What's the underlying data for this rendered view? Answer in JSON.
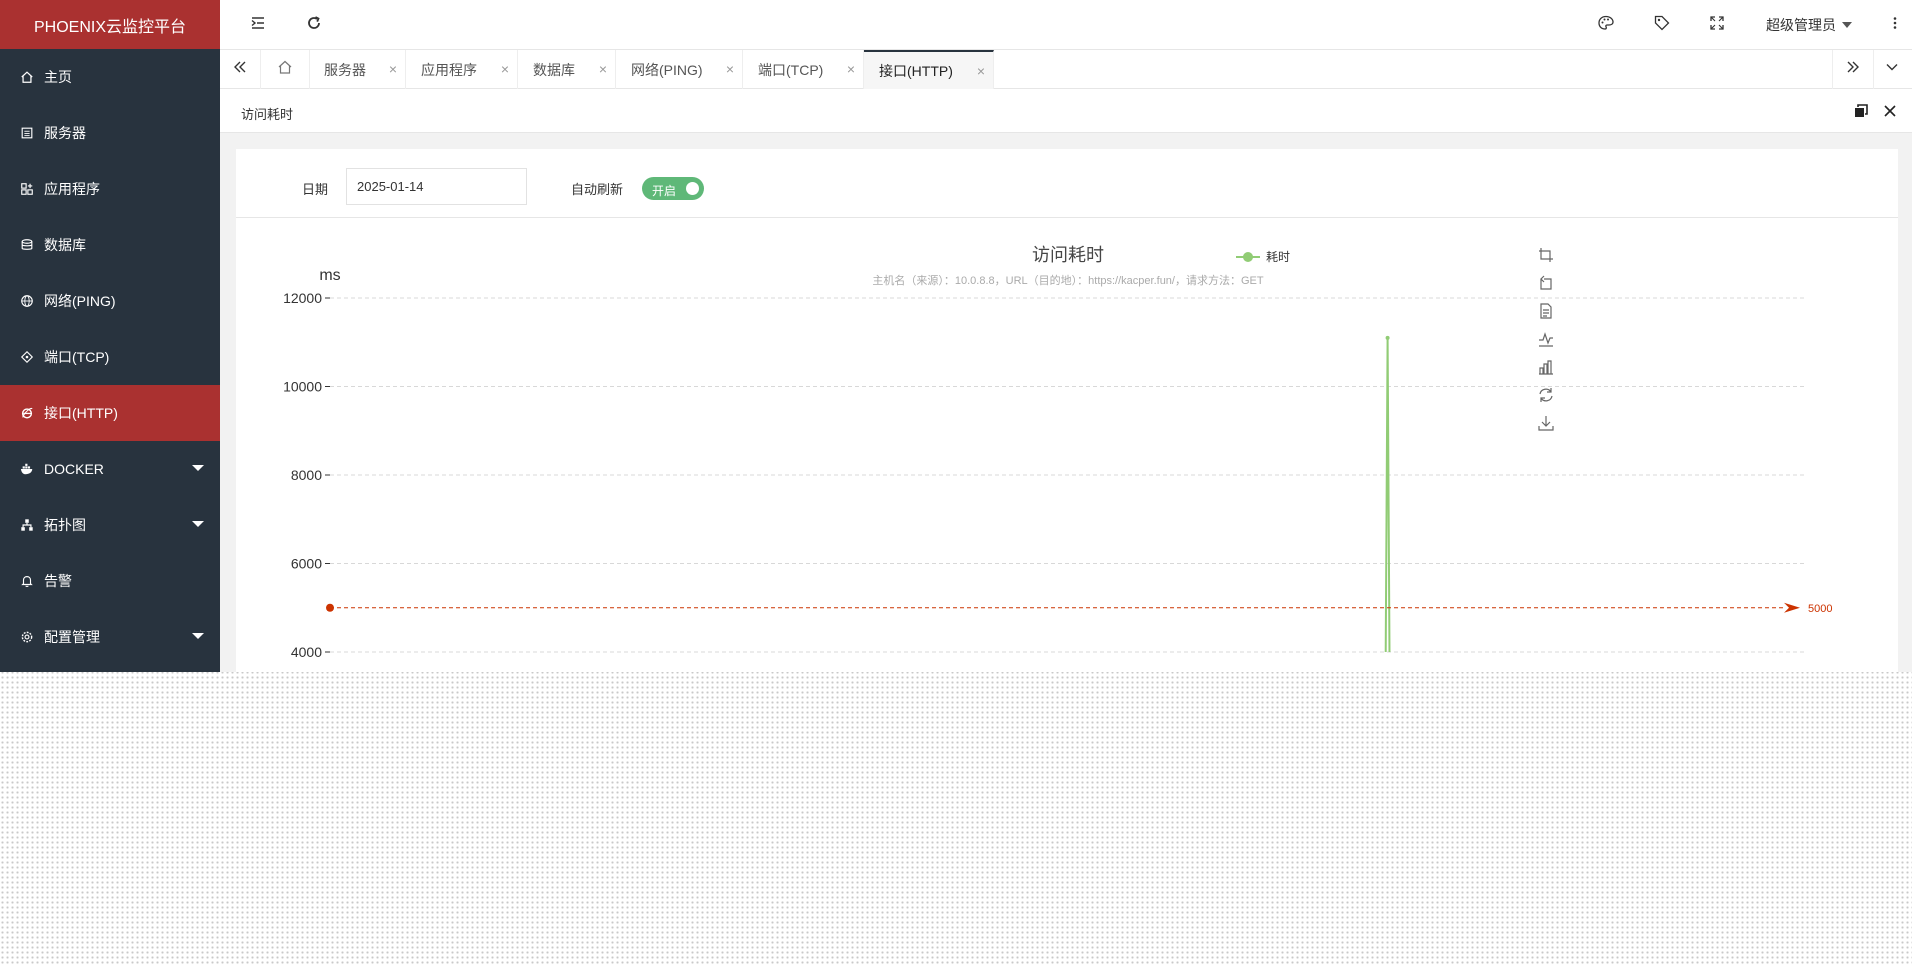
{
  "app": {
    "title": "PHOENIX云监控平台"
  },
  "sidebar": {
    "items": [
      {
        "label": "主页",
        "icon": "home-icon"
      },
      {
        "label": "服务器",
        "icon": "server-icon"
      },
      {
        "label": "应用程序",
        "icon": "app-icon"
      },
      {
        "label": "数据库",
        "icon": "database-icon"
      },
      {
        "label": "网络(PING)",
        "icon": "globe-icon"
      },
      {
        "label": "端口(TCP)",
        "icon": "port-icon"
      },
      {
        "label": "接口(HTTP)",
        "icon": "ie-icon",
        "active": true
      },
      {
        "label": "DOCKER",
        "icon": "docker-icon",
        "expandable": true
      },
      {
        "label": "拓扑图",
        "icon": "topology-icon",
        "expandable": true
      },
      {
        "label": "告警",
        "icon": "bell-icon"
      },
      {
        "label": "配置管理",
        "icon": "gear-icon",
        "expandable": true
      }
    ]
  },
  "header": {
    "user": "超级管理员"
  },
  "tabs": [
    {
      "label": "服务器"
    },
    {
      "label": "应用程序"
    },
    {
      "label": "数据库"
    },
    {
      "label": "网络(PING)"
    },
    {
      "label": "端口(TCP)"
    },
    {
      "label": "接口(HTTP)",
      "active": true
    }
  ],
  "page": {
    "title": "访问耗时"
  },
  "filter": {
    "date_label": "日期",
    "date_value": "2025-01-14",
    "refresh_label": "自动刷新",
    "refresh_state": "开启"
  },
  "colors": {
    "accent": "#aa3130",
    "sidebar": "#28333e",
    "series": "#91cc75",
    "threshold": "#cc3300",
    "switch": "#5fb878"
  },
  "chart_data": {
    "type": "line",
    "title": "访问耗时",
    "subtitle": "主机名（来源）：10.0.8.8，URL（目的地）：https://kacper.fun/，请求方法：GET",
    "ylabel": "ms",
    "xlabel": "",
    "legend": {
      "entries": [
        "耗时"
      ],
      "position": "top-center"
    },
    "y_ticks": [
      4000,
      6000,
      8000,
      10000,
      12000
    ],
    "ylim": [
      4000,
      12000
    ],
    "grid": true,
    "series": [
      {
        "name": "耗时",
        "x": [
          0.0,
          0.7155,
          0.7175,
          0.7195,
          1.0
        ],
        "values": [
          0,
          0,
          11100,
          0,
          0
        ]
      }
    ],
    "markline": {
      "value": 5000,
      "label": "5000"
    },
    "toolbox": [
      "zoom-icon",
      "zoom-reset-icon",
      "data-view-icon",
      "line-chart-icon",
      "bar-chart-icon",
      "restore-icon",
      "download-icon"
    ]
  }
}
